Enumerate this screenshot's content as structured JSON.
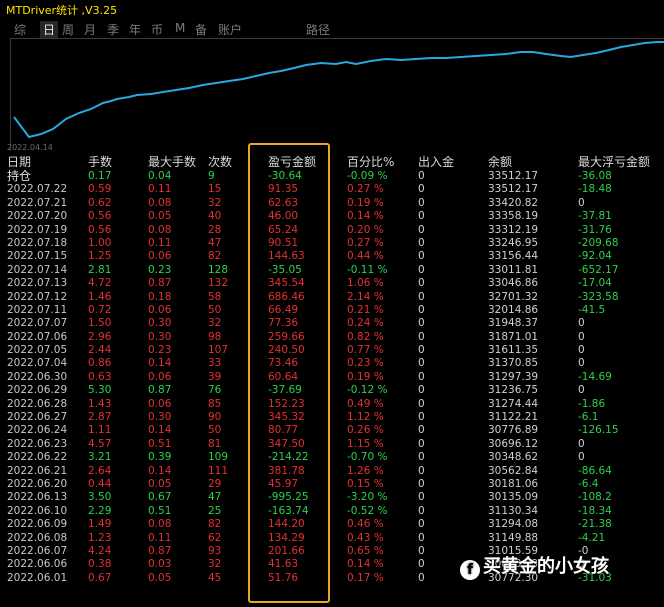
{
  "window": {
    "title": "MTDriver统计 ,V3.25"
  },
  "tabs": [
    "综",
    "日",
    "周",
    "月",
    "季",
    "年",
    "币",
    "M",
    "备",
    "账户",
    "路径"
  ],
  "active_tab": "日",
  "chart": {
    "x_start_label": "2022.04.14",
    "line_color": "#29a8e0"
  },
  "table": {
    "headers": [
      "日期",
      "手数",
      "最大手数",
      "次数",
      "盈亏金额",
      "百分比%",
      "出入金",
      "余额",
      "最大浮亏金额"
    ],
    "hold_row": [
      "持仓",
      "0.17",
      "0.04",
      "9",
      "-30.64",
      "-0.09 %",
      "0",
      "33512.17",
      "-36.08"
    ],
    "rows": [
      [
        "2022.07.22",
        "0.59",
        "0.11",
        "15",
        "91.35",
        "0.27 %",
        "0",
        "33512.17",
        "-18.48"
      ],
      [
        "2022.07.21",
        "0.62",
        "0.08",
        "32",
        "62.63",
        "0.19 %",
        "0",
        "33420.82",
        "0"
      ],
      [
        "2022.07.20",
        "0.56",
        "0.05",
        "40",
        "46.00",
        "0.14 %",
        "0",
        "33358.19",
        "-37.81"
      ],
      [
        "2022.07.19",
        "0.56",
        "0.08",
        "28",
        "65.24",
        "0.20 %",
        "0",
        "33312.19",
        "-31.76"
      ],
      [
        "2022.07.18",
        "1.00",
        "0.11",
        "47",
        "90.51",
        "0.27 %",
        "0",
        "33246.95",
        "-209.68"
      ],
      [
        "2022.07.15",
        "1.25",
        "0.06",
        "82",
        "144.63",
        "0.44 %",
        "0",
        "33156.44",
        "-92.04"
      ],
      [
        "2022.07.14",
        "2.81",
        "0.23",
        "128",
        "-35.05",
        "-0.11 %",
        "0",
        "33011.81",
        "-652.17"
      ],
      [
        "2022.07.13",
        "4.72",
        "0.87",
        "132",
        "345.54",
        "1.06 %",
        "0",
        "33046.86",
        "-17.04"
      ],
      [
        "2022.07.12",
        "1.46",
        "0.18",
        "58",
        "686.46",
        "2.14 %",
        "0",
        "32701.32",
        "-323.58"
      ],
      [
        "2022.07.11",
        "0.72",
        "0.06",
        "50",
        "66.49",
        "0.21 %",
        "0",
        "32014.86",
        "-41.5"
      ],
      [
        "2022.07.07",
        "1.50",
        "0.30",
        "32",
        "77.36",
        "0.24 %",
        "0",
        "31948.37",
        "0"
      ],
      [
        "2022.07.06",
        "2.96",
        "0.30",
        "98",
        "259.66",
        "0.82 %",
        "0",
        "31871.01",
        "0"
      ],
      [
        "2022.07.05",
        "2.44",
        "0.23",
        "107",
        "240.50",
        "0.77 %",
        "0",
        "31611.35",
        "0"
      ],
      [
        "2022.07.04",
        "0.86",
        "0.14",
        "33",
        "73.46",
        "0.23 %",
        "0",
        "31370.85",
        "0"
      ],
      [
        "2022.06.30",
        "0.63",
        "0.06",
        "39",
        "60.64",
        "0.19 %",
        "0",
        "31297.39",
        "-14.69"
      ],
      [
        "2022.06.29",
        "5.30",
        "0.87",
        "76",
        "-37.69",
        "-0.12 %",
        "0",
        "31236.75",
        "0"
      ],
      [
        "2022.06.28",
        "1.43",
        "0.06",
        "85",
        "152.23",
        "0.49 %",
        "0",
        "31274.44",
        "-1.86"
      ],
      [
        "2022.06.27",
        "2.87",
        "0.30",
        "90",
        "345.32",
        "1.12 %",
        "0",
        "31122.21",
        "-6.1"
      ],
      [
        "2022.06.24",
        "1.11",
        "0.14",
        "50",
        "80.77",
        "0.26 %",
        "0",
        "30776.89",
        "-126.15"
      ],
      [
        "2022.06.23",
        "4.57",
        "0.51",
        "81",
        "347.50",
        "1.15 %",
        "0",
        "30696.12",
        "0"
      ],
      [
        "2022.06.22",
        "3.21",
        "0.39",
        "109",
        "-214.22",
        "-0.70 %",
        "0",
        "30348.62",
        "0"
      ],
      [
        "2022.06.21",
        "2.64",
        "0.14",
        "111",
        "381.78",
        "1.26 %",
        "0",
        "30562.84",
        "-86.64"
      ],
      [
        "2022.06.20",
        "0.44",
        "0.05",
        "29",
        "45.97",
        "0.15 %",
        "0",
        "30181.06",
        "-6.4"
      ],
      [
        "2022.06.13",
        "3.50",
        "0.67",
        "47",
        "-995.25",
        "-3.20 %",
        "0",
        "30135.09",
        "-108.2"
      ],
      [
        "2022.06.10",
        "2.29",
        "0.51",
        "25",
        "-163.74",
        "-0.52 %",
        "0",
        "31130.34",
        "-18.34"
      ],
      [
        "2022.06.09",
        "1.49",
        "0.08",
        "82",
        "144.20",
        "0.46 %",
        "0",
        "31294.08",
        "-21.38"
      ],
      [
        "2022.06.08",
        "1.23",
        "0.11",
        "62",
        "134.29",
        "0.43 %",
        "0",
        "31149.88",
        "-4.21"
      ],
      [
        "2022.06.07",
        "4.24",
        "0.87",
        "93",
        "201.66",
        "0.65 %",
        "0",
        "31015.59",
        "-0"
      ],
      [
        "2022.06.06",
        "0.38",
        "0.03",
        "32",
        "41.63",
        "0.14 %",
        "0",
        "30813.93",
        "0"
      ],
      [
        "2022.06.01",
        "0.67",
        "0.05",
        "45",
        "51.76",
        "0.17 %",
        "0",
        "30772.30",
        "-31.03"
      ]
    ]
  },
  "watermark": {
    "text": "买黄金的小女孩",
    "logo": "f"
  }
}
